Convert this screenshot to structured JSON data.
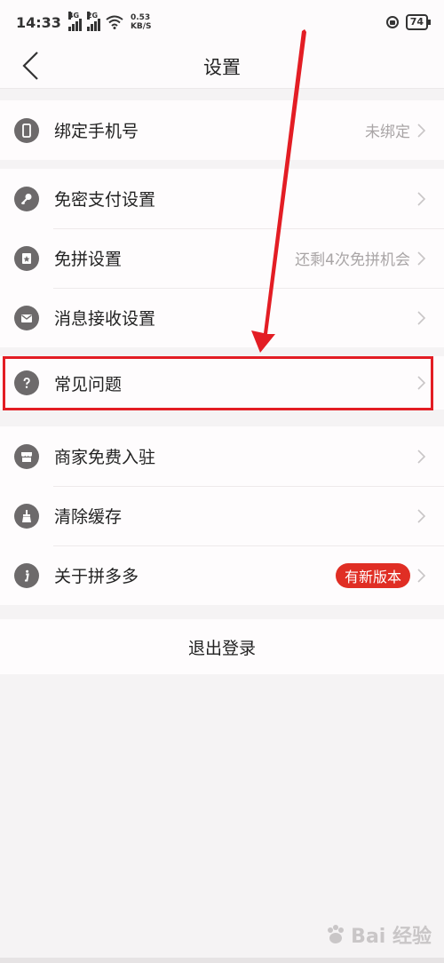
{
  "status": {
    "time": "14:33",
    "net1": "4G",
    "net2": "2G",
    "speed_value": "0.53",
    "speed_unit": "KB/S",
    "battery": "74"
  },
  "nav": {
    "title": "设置"
  },
  "groups": [
    {
      "items": [
        {
          "label": "绑定手机号",
          "value": "未绑定",
          "icon": "phone-icon"
        }
      ]
    },
    {
      "items": [
        {
          "label": "免密支付设置",
          "value": "",
          "icon": "key-icon"
        },
        {
          "label": "免拼设置",
          "value": "还剩4次免拼机会",
          "icon": "coupon-icon"
        },
        {
          "label": "消息接收设置",
          "value": "",
          "icon": "mail-icon"
        }
      ]
    },
    {
      "items": [
        {
          "label": "常见问题",
          "value": "",
          "icon": "question-icon"
        }
      ]
    },
    {
      "items": [
        {
          "label": "商家免费入驻",
          "value": "",
          "icon": "store-icon"
        },
        {
          "label": "清除缓存",
          "value": "",
          "icon": "broom-icon"
        },
        {
          "label": "关于拼多多",
          "value": "",
          "badge": "有新版本",
          "icon": "info-icon"
        }
      ]
    }
  ],
  "logout": {
    "label": "退出登录"
  },
  "watermark": {
    "text": "Bai 经验"
  },
  "colors": {
    "accent_red": "#e31d24",
    "badge_red": "#e02e24",
    "icon_gray": "#6d6a6b"
  }
}
